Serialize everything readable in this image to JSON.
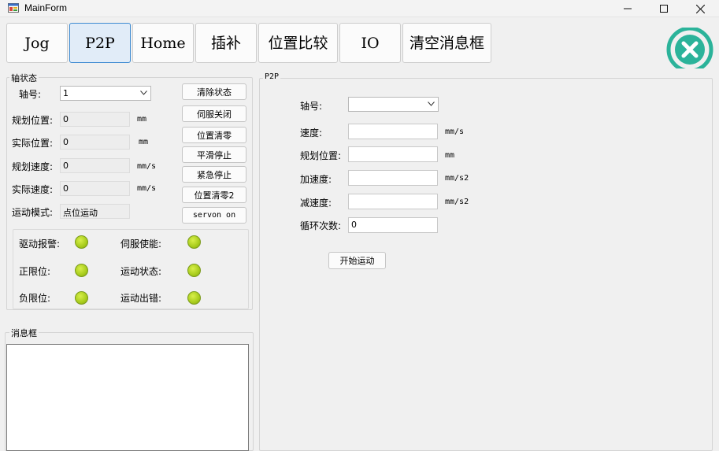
{
  "window": {
    "title": "MainForm"
  },
  "top_tabs": [
    {
      "label": "Jog"
    },
    {
      "label": "P2P"
    },
    {
      "label": "Home"
    },
    {
      "label": "插补"
    },
    {
      "label": "位置比较"
    },
    {
      "label": "IO"
    },
    {
      "label": "清空消息框"
    }
  ],
  "axis_status": {
    "title": "轴状态",
    "axis_label": "轴号:",
    "axis_value": "1",
    "fields": [
      {
        "label": "规划位置:",
        "value": "0",
        "unit": "mm"
      },
      {
        "label": "实际位置:",
        "value": "0",
        "unit": "mm"
      },
      {
        "label": "规划速度:",
        "value": "0",
        "unit": "mm/s"
      },
      {
        "label": "实际速度:",
        "value": "0",
        "unit": "mm/s"
      }
    ],
    "mode_label": "运动模式:",
    "mode_value": "点位运动",
    "buttons": [
      "清除状态",
      "伺服关闭",
      "位置清零",
      "平滑停止",
      "紧急停止",
      "位置清零2",
      "servon on"
    ],
    "indicators": [
      {
        "label": "驱动报警:"
      },
      {
        "label": "伺服使能:"
      },
      {
        "label": "正限位:"
      },
      {
        "label": "运动状态:"
      },
      {
        "label": "负限位:"
      },
      {
        "label": "运动出错:"
      }
    ]
  },
  "message_box": {
    "title": "消息框",
    "content": ""
  },
  "p2p": {
    "title": "P2P",
    "axis_label": "轴号:",
    "axis_value": "",
    "fields": [
      {
        "label": "速度:",
        "value": "",
        "unit": "mm/s"
      },
      {
        "label": "规划位置:",
        "value": "",
        "unit": "mm"
      },
      {
        "label": "加速度:",
        "value": "",
        "unit": "mm/s2"
      },
      {
        "label": "减速度:",
        "value": "",
        "unit": "mm/s2"
      },
      {
        "label": "循环次数:",
        "value": "0",
        "unit": ""
      }
    ],
    "start_button": "开始运动"
  },
  "colors": {
    "active_tab_border": "#3d8ad1",
    "active_tab_bg": "#e1ecf8",
    "logo_teal": "#2bb39a",
    "led_green": "#b5d62a"
  }
}
